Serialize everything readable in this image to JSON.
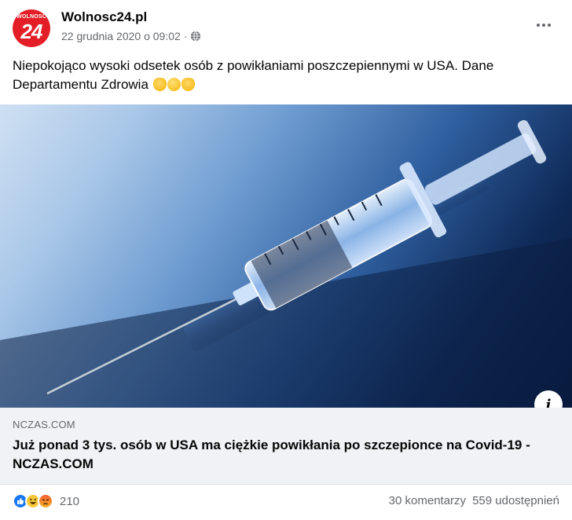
{
  "page": {
    "name": "Wolnosc24.pl",
    "logo_top": "WOLNOSC",
    "logo_num": "24",
    "date": "22 grudnia 2020 o 09:02",
    "separator": "·"
  },
  "post": {
    "text": "Niepokojąco wysoki odsetek osób z powikłaniami poszczepiennymi w USA. Dane Departamentu Zdrowia",
    "emojis": [
      "pointing-down-icon",
      "sneezing-face-icon",
      "pointing-down-icon"
    ]
  },
  "link": {
    "image_alt": "syringe-photo",
    "domain": "NCZAS.COM",
    "title": "Już ponad 3 tys. osób w USA ma ciężkie powikłania po szczepionce na Covid-19 - NCZAS.COM",
    "info_label": "i"
  },
  "footer": {
    "reactions": [
      "like-icon",
      "haha-icon",
      "angry-icon"
    ],
    "reaction_count": "210",
    "comments": "30 komentarzy",
    "shares": "559 udostępnień"
  },
  "colors": {
    "brand_red": "#e41e26",
    "facebook_blue": "#1877f2",
    "secondary_text": "#65676b"
  }
}
